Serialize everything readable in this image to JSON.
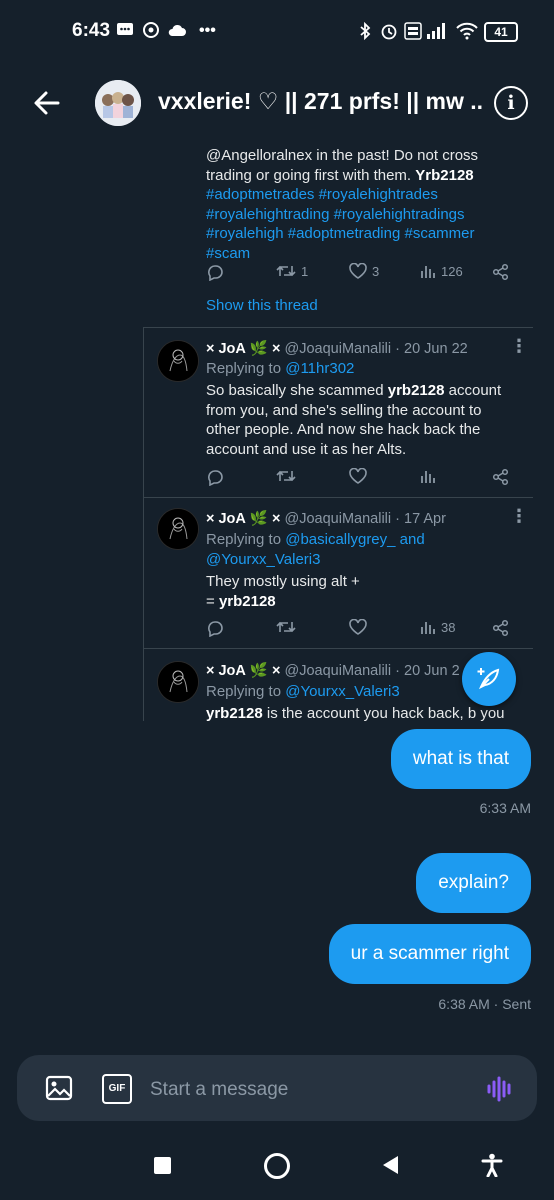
{
  "status_bar": {
    "time": "6:43",
    "battery": "41",
    "more": "•••"
  },
  "header": {
    "title": "vxxlerie! ♡ || 271 prfs! || mw ...",
    "info_icon": "ⓘ"
  },
  "original_tweet": {
    "lines": [
      "@Angelloralnex in the past! Do not cross",
      "trading or going first with them."
    ],
    "bold_word": "Yrb2128",
    "hashtags": [
      "#adoptmetrades #royalehightrades",
      "#royalehightrading #royalehightradings",
      "#royalehigh #adoptmetrading #scammer",
      "#scam"
    ],
    "retweets": "1",
    "likes": "3",
    "views": "126",
    "show_thread": "Show this thread"
  },
  "replies": [
    {
      "name": "× JoA",
      "leaf": "🌿",
      "name_suffix": "×",
      "handle_date": "@JoaquiManalili · 20 Jun 22",
      "replying_prefix": "Replying to ",
      "replying_to": "@11hr302",
      "text_lines": [
        [
          "So basically she scammed ",
          "yrb2128",
          " account"
        ],
        [
          "from you, and she's selling the account to"
        ],
        [
          "other people. And now she hack back the"
        ],
        [
          "account and use it as her Alts."
        ]
      ],
      "views": ""
    },
    {
      "name": "× JoA",
      "leaf": "🌿",
      "name_suffix": "×",
      "handle_date": "@JoaquiManalili · 17 Apr",
      "replying_prefix": "Replying to ",
      "replying_to": "@basicallygrey_ and",
      "replying_to2": "@Yourxx_Valeri3",
      "text_lines": [
        [
          "They mostly using alt +"
        ],
        [
          "= ",
          "yrb2128"
        ]
      ],
      "views": "38"
    },
    {
      "name": "× JoA",
      "leaf": "🌿",
      "name_suffix": "×",
      "handle_date": "@JoaquiManalili · 20 Jun 2",
      "replying_prefix": "Replying to ",
      "replying_to": "@Yourxx_Valeri3",
      "text_lines": [
        [
          "yrb2128",
          " is the account you hack back, b you"
        ]
      ]
    }
  ],
  "messages": [
    {
      "text": "what is that"
    },
    {
      "text": "explain?"
    },
    {
      "text": "ur a scammer right"
    }
  ],
  "timestamps": {
    "first": "6:33 AM",
    "last": "6:38 AM · Sent"
  },
  "composer": {
    "placeholder": "Start a message",
    "gif_label": "GIF"
  },
  "colors": {
    "background": "#15202b",
    "accent": "#1d9bf0",
    "muted": "#8b98a5",
    "voice_icon": "#8b5cf6"
  }
}
